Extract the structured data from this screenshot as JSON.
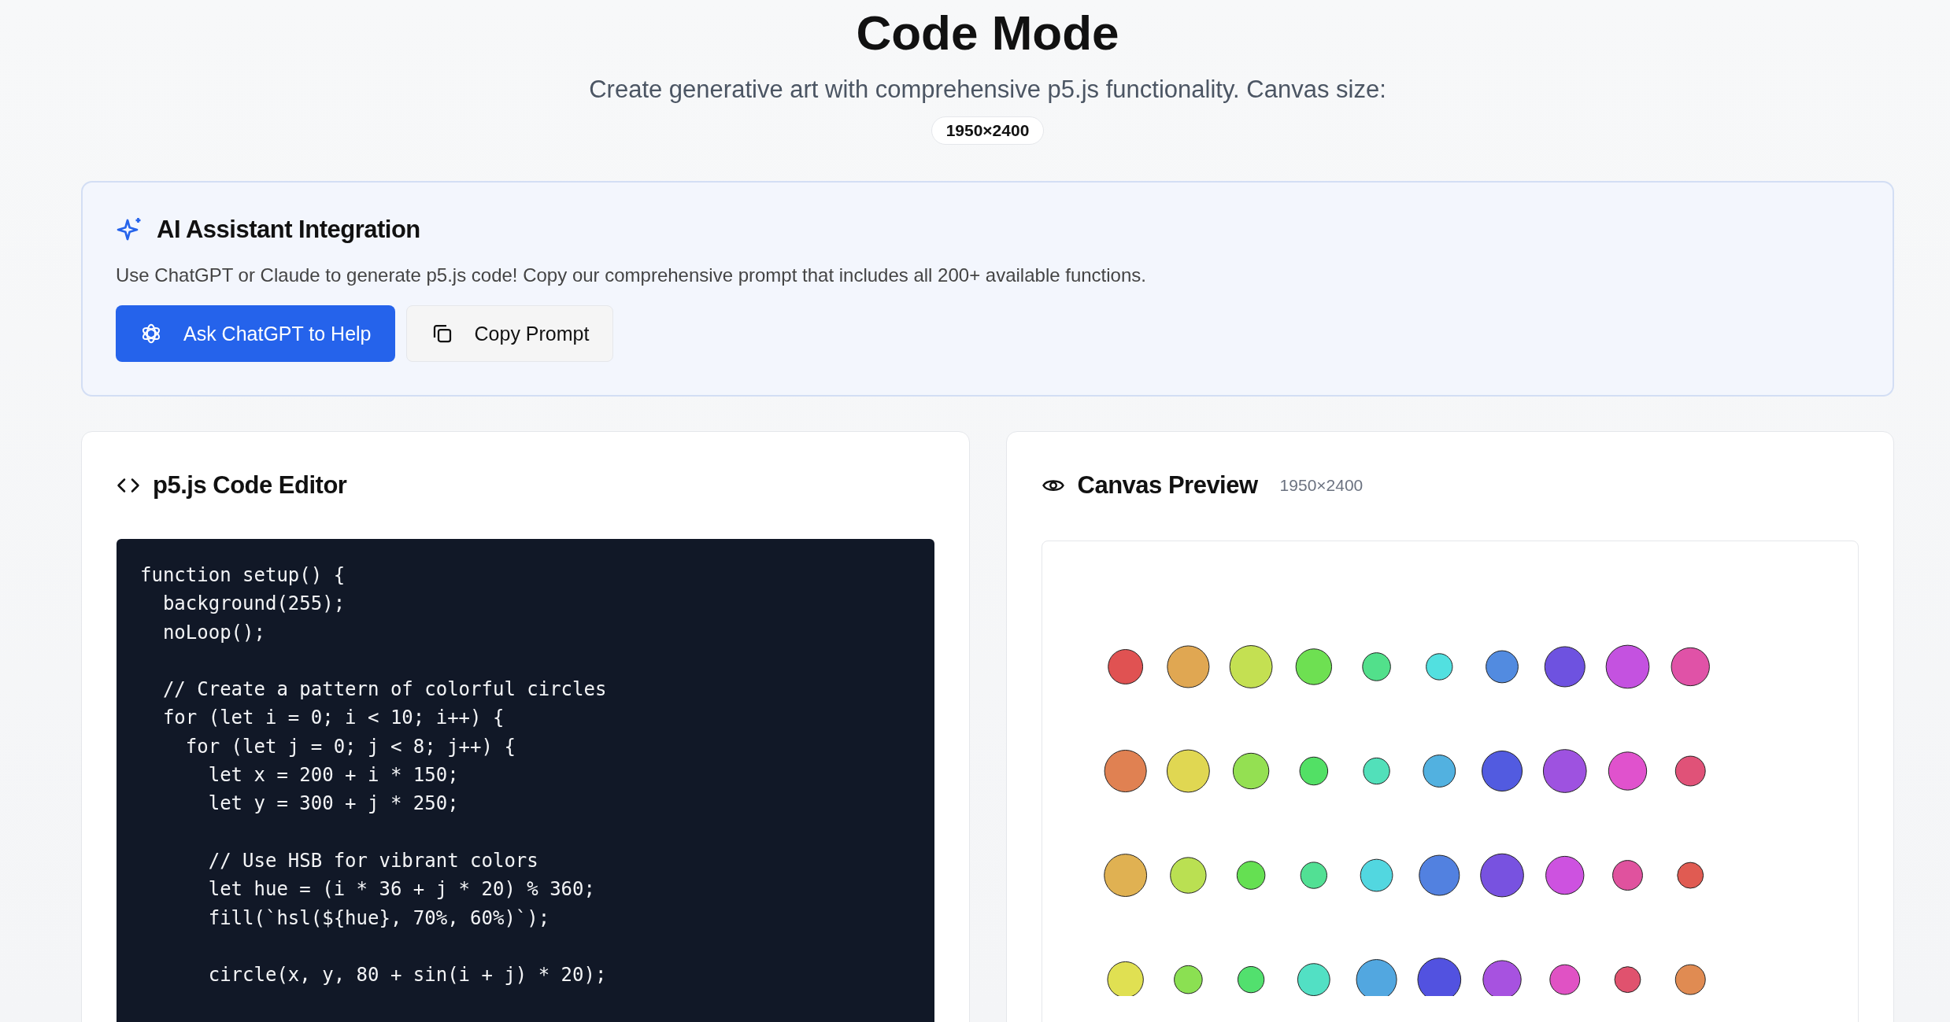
{
  "header": {
    "title": "Code Mode",
    "subtitle": "Create generative art with comprehensive p5.js functionality. Canvas size:",
    "canvas_size": "1950×2400"
  },
  "ai_card": {
    "title": "AI Assistant Integration",
    "description": "Use ChatGPT or Claude to generate p5.js code! Copy our comprehensive prompt that includes all 200+ available functions.",
    "buttons": [
      {
        "kind": "primary",
        "label": "Ask ChatGPT to Help"
      },
      {
        "kind": "secondary",
        "label": "Copy Prompt"
      }
    ]
  },
  "editor": {
    "title": "p5.js Code Editor",
    "code": "function setup() {\n  background(255);\n  noLoop();\n\n  // Create a pattern of colorful circles\n  for (let i = 0; i < 10; i++) {\n    for (let j = 0; j < 8; j++) {\n      let x = 200 + i * 150;\n      let y = 300 + j * 250;\n\n      // Use HSB for vibrant colors\n      let hue = (i * 36 + j * 20) % 360;\n      fill(`hsl(${hue}, 70%, 60%)`);\n\n      circle(x, y, 80 + sin(i + j) * 20);"
  },
  "preview": {
    "title": "Canvas Preview",
    "size": "1950×2400"
  }
}
